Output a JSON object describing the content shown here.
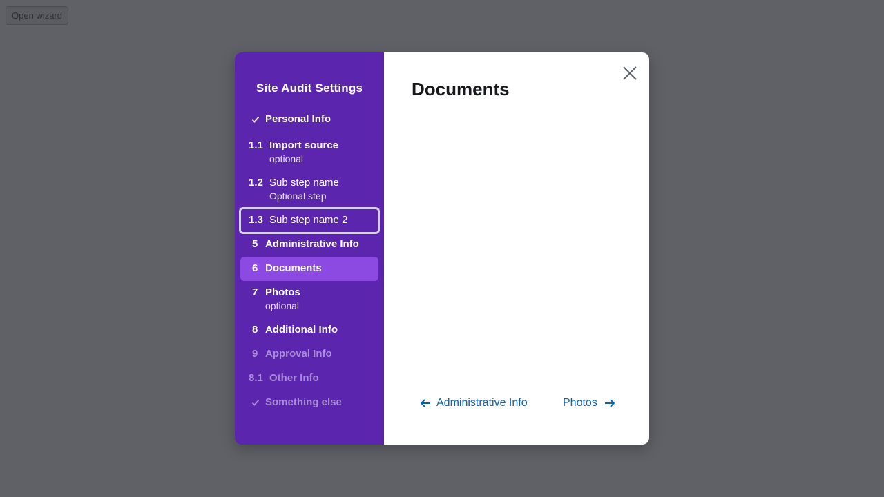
{
  "page": {
    "open_wizard_label": "Open wizard"
  },
  "wizard": {
    "title": "Site Audit Settings",
    "steps": [
      {
        "number": "",
        "label": "Personal Info",
        "state": "completed",
        "icon": "check-icon"
      },
      {
        "number": "1.1",
        "label": "Import source",
        "sublabel": "optional",
        "state": "enabled"
      },
      {
        "number": "1.2",
        "label": "Sub step name",
        "sublabel": "Optional step",
        "state": "enabled"
      },
      {
        "number": "1.3",
        "label": "Sub step name 2",
        "state": "focused"
      },
      {
        "number": "5",
        "label": "Administrative Info",
        "state": "enabled"
      },
      {
        "number": "6",
        "label": "Documents",
        "state": "current"
      },
      {
        "number": "7",
        "label": "Photos",
        "sublabel": "optional",
        "state": "enabled"
      },
      {
        "number": "8",
        "label": "Additional Info",
        "state": "enabled"
      },
      {
        "number": "9",
        "label": "Approval Info",
        "state": "disabled"
      },
      {
        "number": "8.1",
        "label": "Other Info",
        "state": "disabled"
      },
      {
        "number": "",
        "label": "Something else",
        "state": "disabled",
        "icon": "check-icon"
      }
    ],
    "content": {
      "title": "Documents"
    },
    "nav": {
      "prev_label": "Administrative Info",
      "prev_icon": "arrow-left-icon",
      "next_label": "Photos",
      "next_icon": "arrow-right-icon"
    },
    "close_icon": "close-icon"
  },
  "colors": {
    "backdrop": "#5f6166",
    "sidebar": "#5b26ad",
    "active_step": "#8c4ae3",
    "link": "#0a63b7"
  }
}
